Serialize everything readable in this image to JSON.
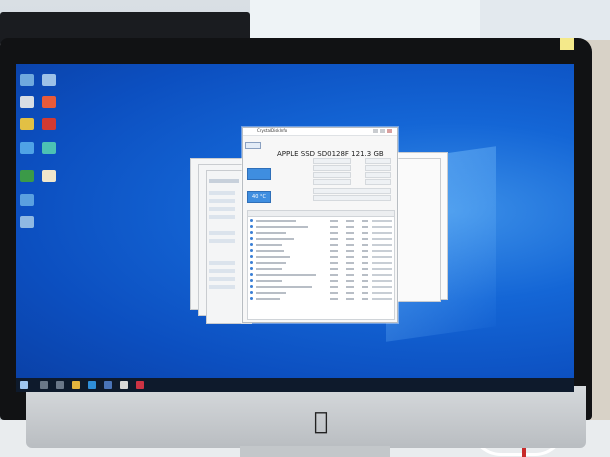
{
  "scene": "iMac displaying Windows 10 desktop with CrystalDiskInfo",
  "window": {
    "title": "CrystalDiskInfo",
    "model": "APPLE SSD SD0128F 121.3 GB",
    "disk_button": "",
    "status_label": "",
    "status_value": "",
    "temp_label": "",
    "temperature": "40 °C",
    "menu": [
      "",
      "",
      "",
      "",
      "",
      "",
      ""
    ]
  },
  "colors": {
    "desktop": "#1466d6",
    "health_good": "#3f8ee0",
    "taskbar": "#0e1a2c",
    "imac_bezel": "#111214",
    "imac_chin": "#c8ccd0"
  },
  "icons": {
    "desktop": [
      "computer-icon",
      "recycle-bin-icon",
      "app-icon",
      "app-icon",
      "folder-icon",
      "network-icon",
      "app-icon",
      "file-icon"
    ],
    "taskbar": [
      "windows-start-icon",
      "search-icon",
      "task-view-icon",
      "explorer-icon",
      "edge-icon",
      "store-icon"
    ],
    "brand": "apple-logo-icon"
  }
}
